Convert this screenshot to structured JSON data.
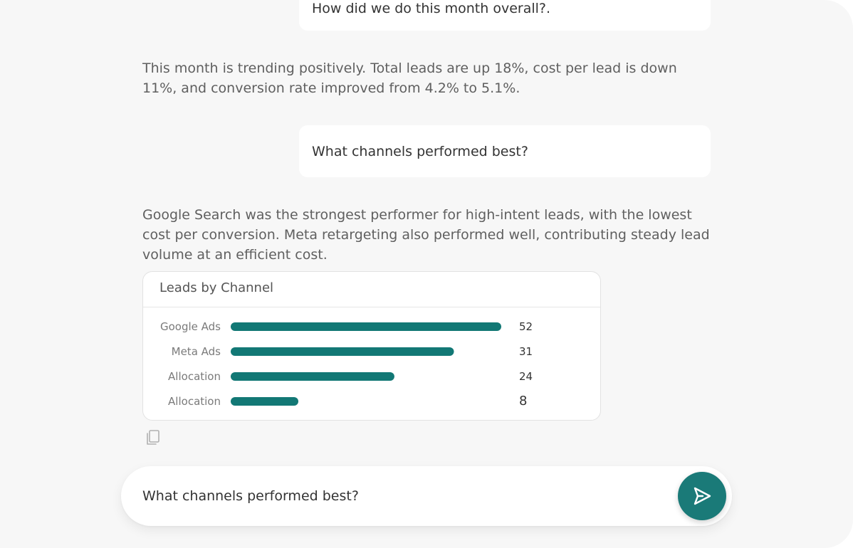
{
  "conversation": {
    "messages": [
      {
        "role": "user",
        "text": "How did we do this month overall?."
      },
      {
        "role": "assistant",
        "text": "This month is trending positively. Total leads are up 18%, cost per lead is down 11%, and conversion rate improved from 4.2% to 5.1%."
      },
      {
        "role": "user",
        "text": "What channels performed best?"
      },
      {
        "role": "assistant",
        "text": "Google Search was the strongest performer for high-intent leads, with the lowest cost per conversion. Meta retargeting also performed well, contributing steady lead volume at an efficient cost."
      }
    ]
  },
  "chart_data": {
    "type": "bar",
    "orientation": "horizontal",
    "title": "Leads by Channel",
    "categories": [
      "Google Ads",
      "Meta Ads",
      "Allocation",
      "Allocation"
    ],
    "values": [
      52,
      31,
      24,
      8
    ],
    "value_labels": [
      "52",
      "31",
      "24",
      "8"
    ],
    "bar_fill": [
      1.0,
      0.825,
      0.605,
      0.25
    ],
    "bar_color": "#127875",
    "grid": false,
    "legend": "none"
  },
  "icons": {
    "copy": "copy-icon",
    "send": "send-icon"
  },
  "composer": {
    "value": "What channels performed best?"
  },
  "colors": {
    "accent": "#1a7a78",
    "background": "#f7f7f7",
    "bar": "#127875"
  }
}
